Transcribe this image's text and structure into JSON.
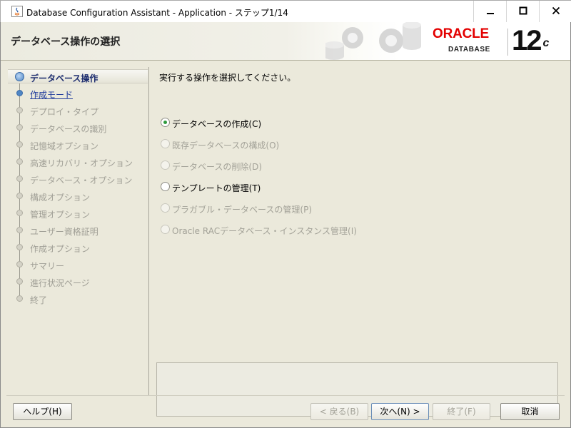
{
  "window": {
    "title": "Database Configuration Assistant - Application - ステップ1/14",
    "controls": {
      "minimize": "minimize-icon",
      "maximize": "maximize-icon",
      "close": "close-icon"
    }
  },
  "banner": {
    "heading": "データベース操作の選択",
    "logo": {
      "word": "ORACLE",
      "sub": "DATABASE",
      "version": "12",
      "version_suffix": "c"
    }
  },
  "steps": [
    {
      "label": "データベース操作",
      "state": "current"
    },
    {
      "label": "作成モード",
      "state": "link"
    },
    {
      "label": "デプロイ・タイプ",
      "state": "disabled"
    },
    {
      "label": "データベースの識別",
      "state": "disabled"
    },
    {
      "label": "記憶域オプション",
      "state": "disabled"
    },
    {
      "label": "高速リカバリ・オプション",
      "state": "disabled"
    },
    {
      "label": "データベース・オプション",
      "state": "disabled"
    },
    {
      "label": "構成オプション",
      "state": "disabled"
    },
    {
      "label": "管理オプション",
      "state": "disabled"
    },
    {
      "label": "ユーザー資格証明",
      "state": "disabled"
    },
    {
      "label": "作成オプション",
      "state": "disabled"
    },
    {
      "label": "サマリー",
      "state": "disabled"
    },
    {
      "label": "進行状況ページ",
      "state": "disabled"
    },
    {
      "label": "終了",
      "state": "disabled"
    }
  ],
  "content": {
    "instruction": "実行する操作を選択してください。",
    "options": [
      {
        "label": "データベースの作成(C)",
        "selected": true,
        "enabled": true
      },
      {
        "label": "既存データベースの構成(O)",
        "selected": false,
        "enabled": false
      },
      {
        "label": "データベースの削除(D)",
        "selected": false,
        "enabled": false
      },
      {
        "label": "テンプレートの管理(T)",
        "selected": false,
        "enabled": true
      },
      {
        "label": "プラガブル・データベースの管理(P)",
        "selected": false,
        "enabled": false
      },
      {
        "label": "Oracle RACデータベース・インスタンス管理(I)",
        "selected": false,
        "enabled": false
      }
    ],
    "message": ""
  },
  "buttons": {
    "help": "ヘルプ(H)",
    "back": "< 戻る(B)",
    "next": "次へ(N) >",
    "finish": "終了(F)",
    "cancel": "取消"
  },
  "colors": {
    "frame_bg": "#ebe9db",
    "oracle_red": "#e30000",
    "current_step_text": "#1b2b6e",
    "link_text": "#1f3b9c",
    "radio_checked": "#2e9a3c"
  }
}
